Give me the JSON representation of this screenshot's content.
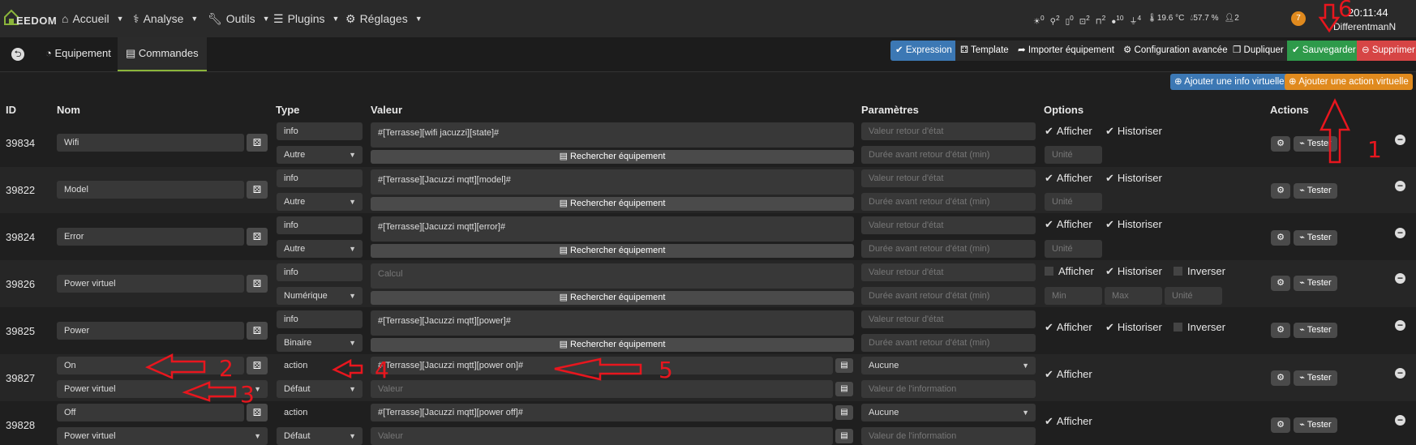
{
  "logo": {
    "text": "EEDOM"
  },
  "nav": {
    "accueil": "Accueil",
    "analyse": "Analyse",
    "outils": "Outils",
    "plugins": "Plugins",
    "reglages": "Réglages"
  },
  "sensors": [
    "0",
    "2",
    "0",
    "2",
    "2",
    "10",
    "4",
    "19.6 °C",
    "57.7 %",
    "2"
  ],
  "header": {
    "notifications": "7",
    "time": "20:11:44",
    "user": "DifferentmanN"
  },
  "tabs": {
    "equipement": "Equipement",
    "commandes": "Commandes"
  },
  "actions": {
    "expression": "Expression",
    "template": "Template",
    "import": "Importer équipement",
    "config": "Configuration avancée",
    "duplicate": "Dupliquer",
    "save": "Sauvegarder",
    "delete": "Supprimer"
  },
  "add": {
    "info": "Ajouter une info virtuelle",
    "action": "Ajouter une action virtuelle"
  },
  "columns": {
    "id": "ID",
    "name": "Nom",
    "type": "Type",
    "value": "Valeur",
    "params": "Paramètres",
    "options": "Options",
    "actions": "Actions"
  },
  "placeholders": {
    "retour": "Valeur retour d'état",
    "duree": "Durée avant retour d'état (min)",
    "unite": "Unité",
    "calcul": "Calcul",
    "min": "Min",
    "max": "Max",
    "valeur": "Valeur",
    "valeur_info": "Valeur de l'information"
  },
  "labels": {
    "search": "Rechercher équipement",
    "afficher": "Afficher",
    "historiser": "Historiser",
    "inverser": "Inverser",
    "tester": "Tester"
  },
  "rows": [
    {
      "id": "39834",
      "name": "Wifi",
      "type": "info",
      "subtype": "Autre",
      "value": "#[Terrasse][wifi jacuzzi][state]#"
    },
    {
      "id": "39822",
      "name": "Model",
      "type": "info",
      "subtype": "Autre",
      "value": "#[Terrasse][Jacuzzi mqtt][model]#"
    },
    {
      "id": "39824",
      "name": "Error",
      "type": "info",
      "subtype": "Autre",
      "value": "#[Terrasse][Jacuzzi mqtt][error]#"
    },
    {
      "id": "39826",
      "name": "Power virtuel",
      "type": "info",
      "subtype": "Numérique",
      "value": ""
    },
    {
      "id": "39825",
      "name": "Power",
      "type": "info",
      "subtype": "Binaire",
      "value": "#[Terrasse][Jacuzzi mqtt][power]#"
    },
    {
      "id": "39827",
      "name": "On",
      "linked": "Power virtuel",
      "type": "action",
      "subtype": "Défaut",
      "value": "#[Terrasse][Jacuzzi mqtt][power on]#",
      "param": "Aucune"
    },
    {
      "id": "39828",
      "name": "Off",
      "linked": "Power virtuel",
      "type": "action",
      "subtype": "Défaut",
      "value": "#[Terrasse][Jacuzzi mqtt][power off]#",
      "param": "Aucune"
    }
  ],
  "annotations": [
    "1",
    "2",
    "3",
    "4",
    "5",
    "6"
  ],
  "colors": {
    "expression": "#3c78b4",
    "save": "#2e9a4a",
    "delete": "#d64545",
    "addinfo": "#3c78b4",
    "addaction": "#e08a1e"
  }
}
